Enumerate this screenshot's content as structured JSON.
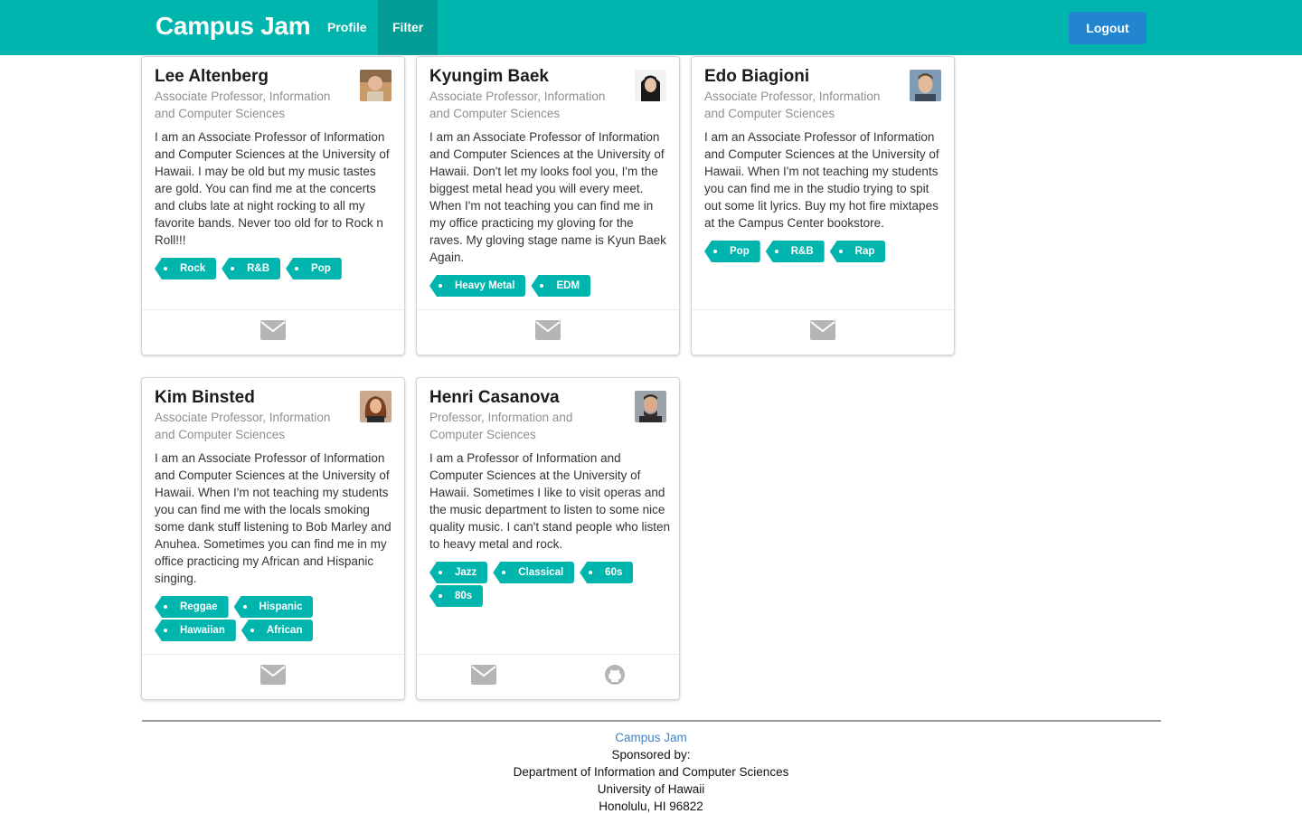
{
  "nav": {
    "brand": "Campus Jam",
    "profile": "Profile",
    "filter": "Filter",
    "logout": "Logout",
    "bg_color": "#00b5ad",
    "logout_color": "#2185d0"
  },
  "cards": [
    {
      "name": "Lee Altenberg",
      "title": "Associate Professor, Information and Computer Sciences",
      "description": "I am an Associate Professor of Information and Computer Sciences at the University of Hawaii. I may be old but my music tastes are gold. You can find me at the concerts and clubs late at night rocking to all my favorite bands. Never too old for to Rock n Roll!!!",
      "tags": [
        "Rock",
        "R&B",
        "Pop"
      ],
      "icons": [
        "mail-icon"
      ]
    },
    {
      "name": "Kyungim Baek",
      "title": "Associate Professor, Information and Computer Sciences",
      "description": "I am an Associate Professor of Information and Computer Sciences at the University of Hawaii. Don't let my looks fool you, I'm the biggest metal head you will every meet. When I'm not teaching you can find me in my office practicing my gloving for the raves. My gloving stage name is Kyun Baek Again.",
      "tags": [
        "Heavy Metal",
        "EDM"
      ],
      "icons": [
        "mail-icon"
      ]
    },
    {
      "name": "Edo Biagioni",
      "title": "Associate Professor, Information and Computer Sciences",
      "description": "I am an Associate Professor of Information and Computer Sciences at the University of Hawaii. When I'm not teaching my students you can find me in the studio trying to spit out some lit lyrics. Buy my hot fire mixtapes at the Campus Center bookstore.",
      "tags": [
        "Pop",
        "R&B",
        "Rap"
      ],
      "icons": [
        "mail-icon"
      ]
    },
    {
      "name": "Kim Binsted",
      "title": "Associate Professor, Information and Computer Sciences",
      "description": "I am an Associate Professor of Information and Computer Sciences at the University of Hawaii. When I'm not teaching my students you can find me with the locals smoking some dank stuff listening to Bob Marley and Anuhea. Sometimes you can find me in my office practicing my African and Hispanic singing.",
      "tags": [
        "Reggae",
        "Hispanic",
        "Hawaiian",
        "African"
      ],
      "icons": [
        "mail-icon"
      ]
    },
    {
      "name": "Henri Casanova",
      "title": "Professor, Information and Computer Sciences",
      "description": "I am a Professor of Information and Computer Sciences at the University of Hawaii. Sometimes I like to visit operas and the music department to listen to some nice quality music. I can't stand people who listen to heavy metal and rock.",
      "tags": [
        "Jazz",
        "Classical",
        "60s",
        "80s"
      ],
      "icons": [
        "mail-icon",
        "github-icon"
      ]
    }
  ],
  "footer": {
    "title": "Campus Jam",
    "sponsored": "Sponsored by:",
    "department": "Department of Information and Computer Sciences",
    "university": "University of Hawaii",
    "address": "Honolulu, HI 96822"
  }
}
